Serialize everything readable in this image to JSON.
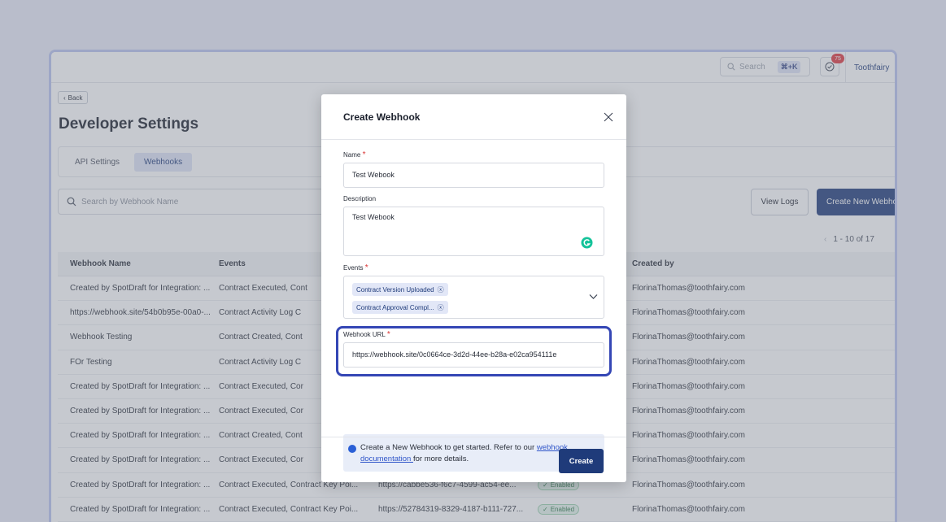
{
  "topbar": {
    "search_label": "Search",
    "search_shortcut": "⌘+K",
    "notification_count": "75",
    "org_name": "Toothfairy"
  },
  "page": {
    "back_label": "Back",
    "title": "Developer Settings",
    "tabs": [
      {
        "label": "API Settings",
        "active": false
      },
      {
        "label": "Webhooks",
        "active": true
      }
    ],
    "search_placeholder": "Search by Webhook Name",
    "view_logs_label": "View Logs",
    "create_new_label": "Create New Webhook",
    "pagination": "1 - 10 of 17"
  },
  "table": {
    "headers": [
      "Webhook Name",
      "Events",
      "",
      "",
      "Created by"
    ],
    "rows": [
      {
        "name": "Created by SpotDraft for Integration: ...",
        "events": "Contract Executed, Cont",
        "url": "",
        "status": "",
        "created_by": "FlorinaThomas@toothfairy.com"
      },
      {
        "name": "https://webhook.site/54b0b95e-00a0-...",
        "events": "Contract Activity Log C",
        "url": "",
        "status": "",
        "created_by": "FlorinaThomas@toothfairy.com"
      },
      {
        "name": "Webhook Testing",
        "events": "Contract Created, Cont",
        "url": "",
        "status": "",
        "created_by": "FlorinaThomas@toothfairy.com"
      },
      {
        "name": "FOr Testing",
        "events": "Contract Activity Log C",
        "url": "",
        "status": "",
        "created_by": "FlorinaThomas@toothfairy.com"
      },
      {
        "name": "Created by SpotDraft for Integration: ...",
        "events": "Contract Executed, Cor",
        "url": "",
        "status": "",
        "created_by": "FlorinaThomas@toothfairy.com"
      },
      {
        "name": "Created by SpotDraft for Integration: ...",
        "events": "Contract Executed, Cor",
        "url": "",
        "status": "",
        "created_by": "FlorinaThomas@toothfairy.com"
      },
      {
        "name": "Created by SpotDraft for Integration: ...",
        "events": "Contract Created, Cont",
        "url": "",
        "status": "",
        "created_by": "FlorinaThomas@toothfairy.com"
      },
      {
        "name": "Created by SpotDraft for Integration: ...",
        "events": "Contract Executed, Cor",
        "url": "",
        "status": "",
        "created_by": "FlorinaThomas@toothfairy.com"
      },
      {
        "name": "Created by SpotDraft for Integration: ...",
        "events": "Contract Executed, Contract Key Poi...",
        "url": "https://cabbe536-f6c7-4599-ac54-ee...",
        "status": "Enabled",
        "created_by": "FlorinaThomas@toothfairy.com"
      },
      {
        "name": "Created by SpotDraft for Integration: ...",
        "events": "Contract Executed, Contract Key Poi...",
        "url": "https://52784319-8329-4187-b111-727...",
        "status": "Enabled",
        "created_by": "FlorinaThomas@toothfairy.com"
      }
    ]
  },
  "modal": {
    "title": "Create Webhook",
    "name_label": "Name",
    "name_value": "Test Webook",
    "description_label": "Description",
    "description_value": "Test Webook",
    "events_label": "Events",
    "events_chips": [
      "Contract Version Uploaded",
      "Contract Approval Compl..."
    ],
    "url_label": "Webhook URL",
    "url_value": "https://webhook.site/0c0664ce-3d2d-44ee-b28a-e02ca954111e",
    "info_text_before": "Create a New Webhook to get started. Refer to our ",
    "info_link_part1": "webhook",
    "info_link_part2": "documentation ",
    "info_text_after": "for more details.",
    "create_label": "Create"
  },
  "colors": {
    "accent": "#1f3b7a",
    "highlight": "#3446b5",
    "required": "#d93434"
  }
}
